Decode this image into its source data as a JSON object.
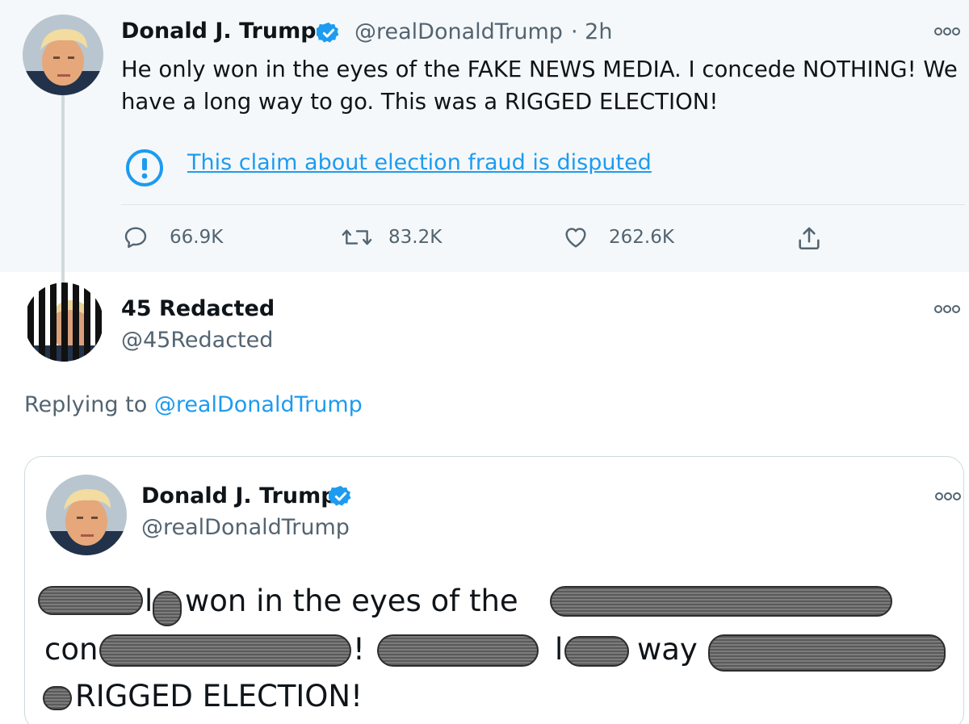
{
  "main_tweet": {
    "author_name": "Donald J. Trump",
    "handle": "@realDonaldTrump",
    "time": "· 2h",
    "text_line1": "He only won in the eyes of the FAKE NEWS MEDIA. I concede NOTHING! We",
    "text_line2": "have a long way to go. This was a RIGGED ELECTION!",
    "notice_label": "This claim about election fraud is disputed",
    "actions": {
      "replies": "66.9K",
      "retweets": "83.2K",
      "likes": "262.6K"
    }
  },
  "reply_tweet": {
    "author_name": "45 Redacted",
    "handle": "@45Redacted",
    "replying_prefix": "Replying to",
    "replying_to": "@realDonaldTrump"
  },
  "quote_tweet": {
    "author_name": "Donald J. Trump",
    "handle": "@realDonaldTrump",
    "line1_a": "l",
    "line1_b": "won in the eyes of the",
    "line2_a": "con",
    "line2_b": "!",
    "line2_c": "l",
    "line2_d": "way",
    "line3": "RIGGED ELECTION!"
  },
  "colors": {
    "accent": "#1d9bf0",
    "muted_text": "#536471",
    "top_background": "#f5f8fa"
  },
  "icons": [
    "verified-badge-icon",
    "more-options-icon",
    "disputed-notice-icon",
    "reply-icon",
    "retweet-icon",
    "like-icon",
    "share-icon"
  ]
}
